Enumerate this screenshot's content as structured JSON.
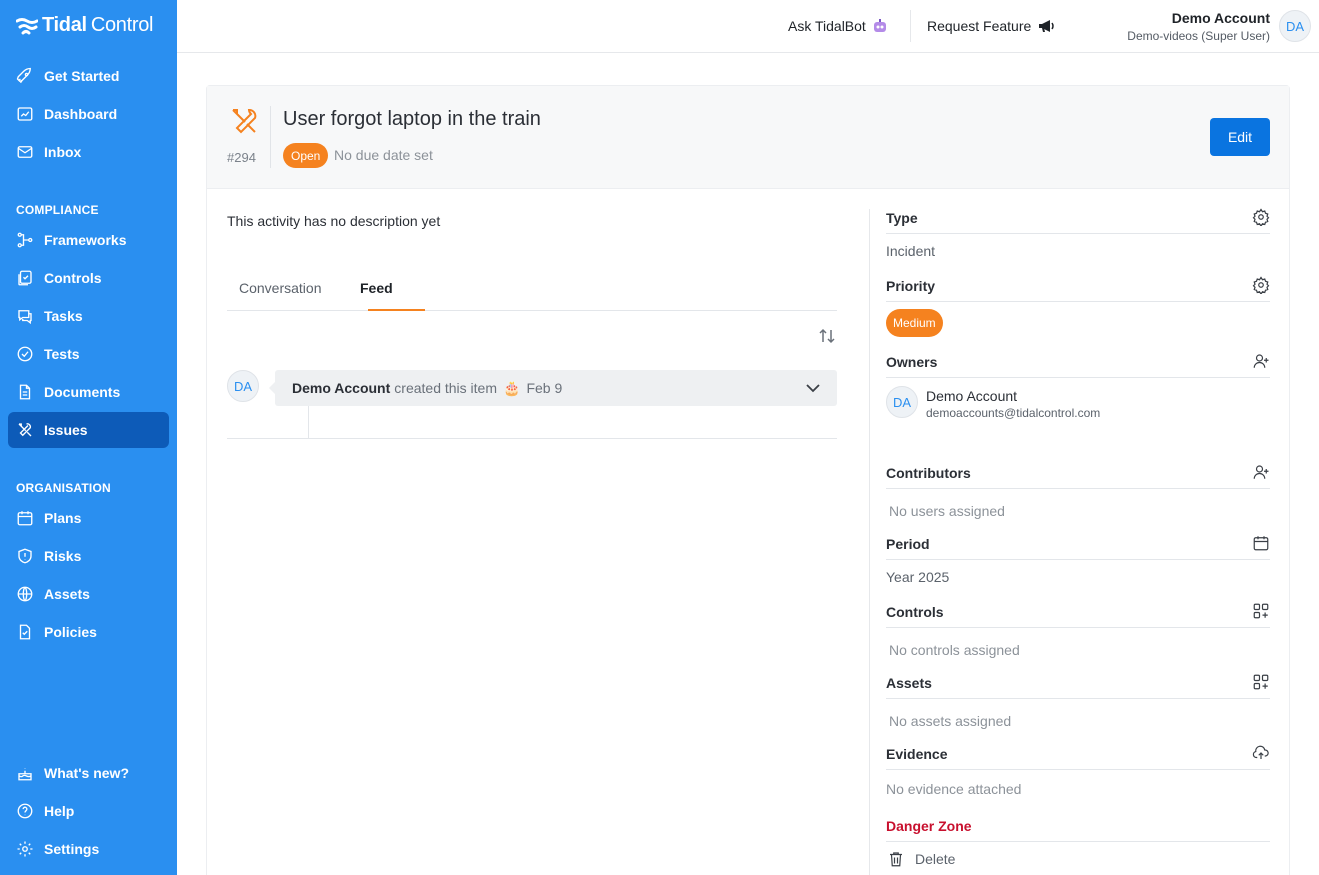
{
  "brand": {
    "part1": "Tidal",
    "part2": "Control"
  },
  "sidebar": {
    "items": [
      {
        "label": "Get Started",
        "icon": "rocket-icon"
      },
      {
        "label": "Dashboard",
        "icon": "dashboard-icon"
      },
      {
        "label": "Inbox",
        "icon": "mail-icon"
      }
    ],
    "compliance_heading": "COMPLIANCE",
    "compliance_items": [
      {
        "label": "Frameworks",
        "icon": "frameworks-icon"
      },
      {
        "label": "Controls",
        "icon": "controls-icon"
      },
      {
        "label": "Tasks",
        "icon": "chat-icon"
      },
      {
        "label": "Tests",
        "icon": "check-circle-icon"
      },
      {
        "label": "Documents",
        "icon": "document-icon"
      },
      {
        "label": "Issues",
        "icon": "tools-icon",
        "active": true
      }
    ],
    "organisation_heading": "ORGANISATION",
    "organisation_items": [
      {
        "label": "Plans",
        "icon": "calendar-icon"
      },
      {
        "label": "Risks",
        "icon": "shield-icon"
      },
      {
        "label": "Assets",
        "icon": "globe-icon"
      },
      {
        "label": "Policies",
        "icon": "policy-icon"
      }
    ],
    "bottom_items": [
      {
        "label": "What's new?",
        "icon": "cake-icon"
      },
      {
        "label": "Help",
        "icon": "help-icon"
      },
      {
        "label": "Settings",
        "icon": "gear-icon"
      }
    ]
  },
  "header": {
    "ask_bot": "Ask TidalBot",
    "request_feature": "Request Feature",
    "account_name": "Demo Account",
    "account_sub": "Demo-videos (Super User)",
    "account_initials": "DA"
  },
  "issue": {
    "title": "User forgot laptop in the train",
    "number": "#294",
    "status": "Open",
    "due": "No due date set",
    "edit_label": "Edit",
    "description": "This activity has no description yet"
  },
  "tabs": [
    "Conversation",
    "Feed"
  ],
  "active_tab": "Feed",
  "feed": {
    "initials": "DA",
    "author": "Demo Account",
    "verb": "created this item",
    "emoji": "🎂",
    "date": "Feb 9"
  },
  "panel": {
    "type_label": "Type",
    "type_value": "Incident",
    "priority_label": "Priority",
    "priority_value": "Medium",
    "owners_label": "Owners",
    "owner_initials": "DA",
    "owner_name": "Demo Account",
    "owner_email": "demoaccounts@tidalcontrol.com",
    "contributors_label": "Contributors",
    "contributors_empty": "No users assigned",
    "period_label": "Period",
    "period_value": "Year 2025",
    "controls_label": "Controls",
    "controls_empty": "No controls assigned",
    "assets_label": "Assets",
    "assets_empty": "No assets assigned",
    "evidence_label": "Evidence",
    "evidence_empty": "No evidence attached",
    "danger_label": "Danger Zone",
    "delete_label": "Delete"
  },
  "colors": {
    "sidebar": "#2a8ff0",
    "sidebar_active": "#0d5bb8",
    "accent_orange": "#f5821f",
    "primary_button": "#0a74e0",
    "danger": "#c8102e"
  }
}
